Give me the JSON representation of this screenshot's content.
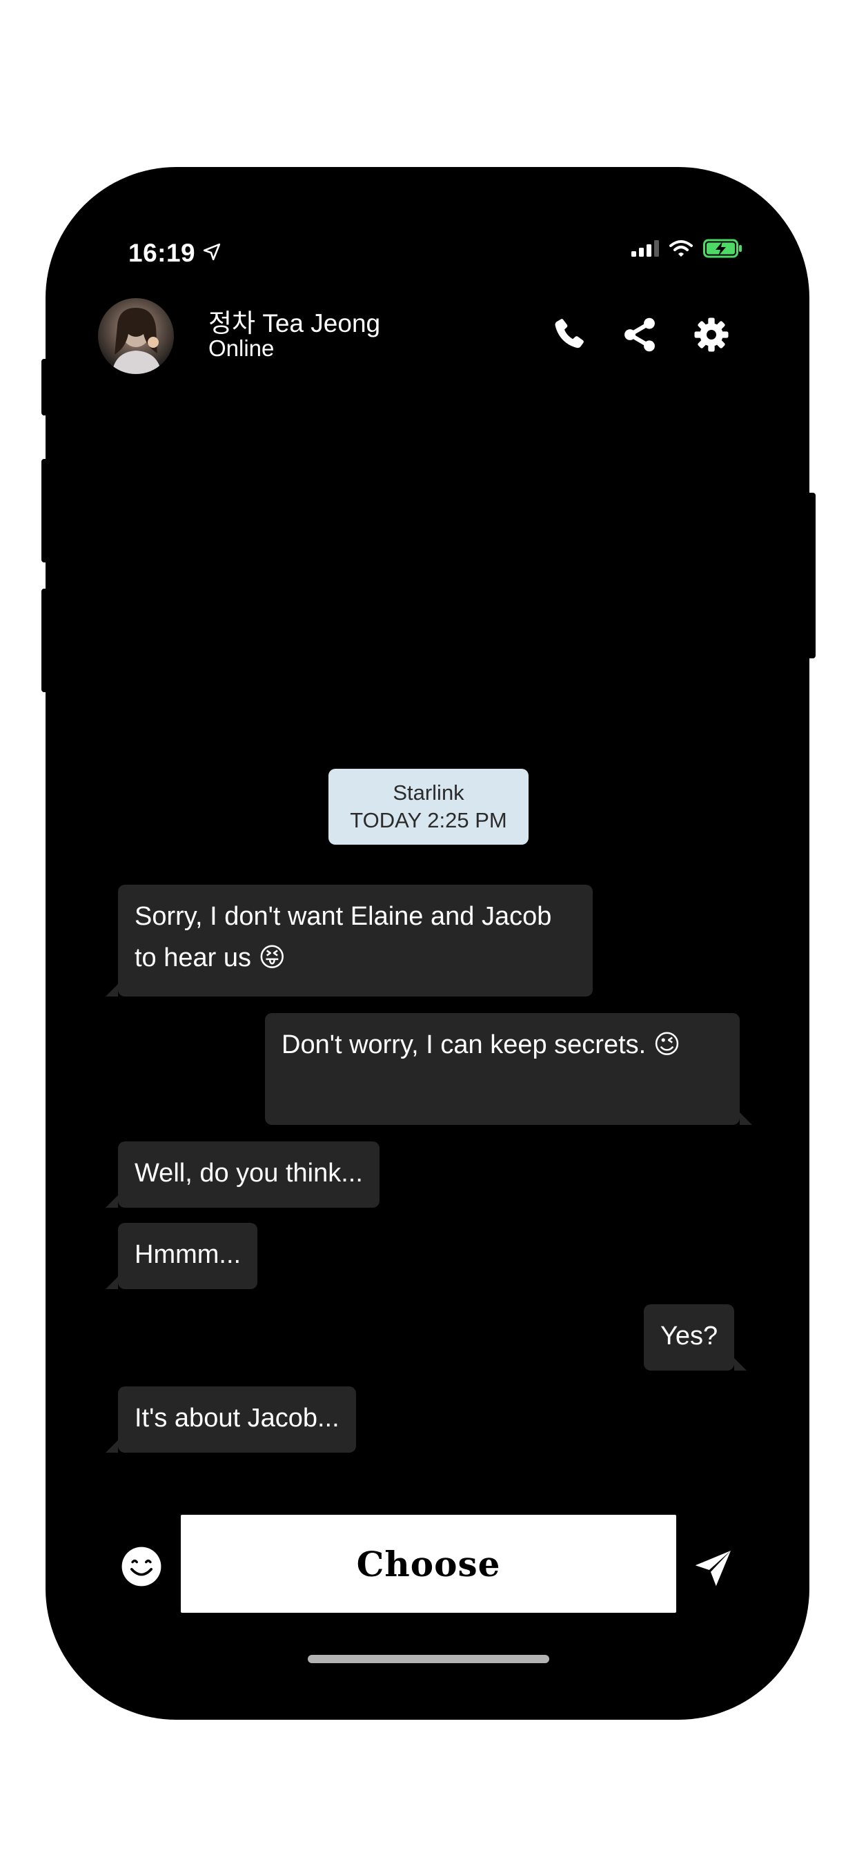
{
  "status_bar": {
    "time": "16:19",
    "icons": [
      "location-arrow-icon",
      "signal-icon",
      "wifi-icon",
      "battery-charging-icon"
    ]
  },
  "header": {
    "contact_name": "정차 Tea Jeong",
    "contact_status": "Online",
    "actions": [
      "phone-icon",
      "share-icon",
      "gear-icon"
    ]
  },
  "timestamp": {
    "line1": "Starlink",
    "line2": "TODAY 2:25 PM"
  },
  "messages": [
    {
      "direction": "incoming",
      "text": "Sorry, I don't want Elaine and Jacob to hear us 😝"
    },
    {
      "direction": "outgoing",
      "text": "Don't worry, I can keep secrets. 😉"
    },
    {
      "direction": "incoming",
      "text": "Well, do you think..."
    },
    {
      "direction": "incoming",
      "text": "Hmmm..."
    },
    {
      "direction": "outgoing",
      "text": "Yes?"
    },
    {
      "direction": "incoming",
      "text": "It's about Jacob..."
    }
  ],
  "input_bar": {
    "choose_label": "Choose",
    "emoji_icon": "smiley-icon",
    "send_icon": "send-icon"
  },
  "colors": {
    "background": "#000000",
    "bubble": "#262626",
    "timestamp_chip": "#d8e6f0",
    "battery": "#4cd964"
  }
}
